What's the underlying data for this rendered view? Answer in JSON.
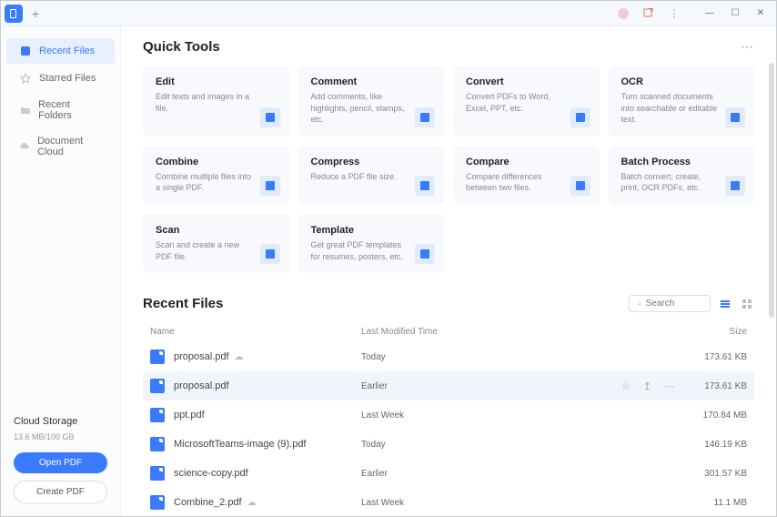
{
  "sidebar": {
    "items": [
      {
        "label": "Recent Files",
        "icon": "clock"
      },
      {
        "label": "Starred Files",
        "icon": "star"
      },
      {
        "label": "Recent Folders",
        "icon": "folder"
      },
      {
        "label": "Document Cloud",
        "icon": "cloud"
      }
    ],
    "storage_title": "Cloud Storage",
    "storage_info": "13.6 MB/100 GB",
    "open_btn": "Open PDF",
    "create_btn": "Create PDF"
  },
  "quick_tools": {
    "title": "Quick Tools",
    "cards": [
      {
        "title": "Edit",
        "desc": "Edit texts and images in a file."
      },
      {
        "title": "Comment",
        "desc": "Add comments, like highlights, pencil, stamps, etc."
      },
      {
        "title": "Convert",
        "desc": "Convert PDFs to Word, Excel, PPT, etc."
      },
      {
        "title": "OCR",
        "desc": "Turn scanned documents into searchable or editable text."
      },
      {
        "title": "Combine",
        "desc": "Combine multiple files into a single PDF."
      },
      {
        "title": "Compress",
        "desc": "Reduce a PDF file size."
      },
      {
        "title": "Compare",
        "desc": "Compare differences between two files."
      },
      {
        "title": "Batch Process",
        "desc": "Batch convert, create, print, OCR PDFs, etc."
      },
      {
        "title": "Scan",
        "desc": "Scan and create a new PDF file."
      },
      {
        "title": "Template",
        "desc": "Get great PDF templates for resumes, posters, etc."
      }
    ]
  },
  "recent": {
    "title": "Recent Files",
    "search_placeholder": "Search",
    "columns": {
      "name": "Name",
      "time": "Last Modified Time",
      "size": "Size"
    },
    "files": [
      {
        "name": "proposal.pdf",
        "time": "Today",
        "size": "173.61 KB",
        "cloud": true
      },
      {
        "name": "proposal.pdf",
        "time": "Earlier",
        "size": "173.61 KB",
        "hover": true,
        "actions": true
      },
      {
        "name": "ppt.pdf",
        "time": "Last Week",
        "size": "170.84 MB"
      },
      {
        "name": "MicrosoftTeams-image (9).pdf",
        "time": "Today",
        "size": "146.19 KB"
      },
      {
        "name": "science-copy.pdf",
        "time": "Earlier",
        "size": "301.57 KB"
      },
      {
        "name": "Combine_2.pdf",
        "time": "Last Week",
        "size": "11.1 MB",
        "cloud": true
      }
    ]
  }
}
